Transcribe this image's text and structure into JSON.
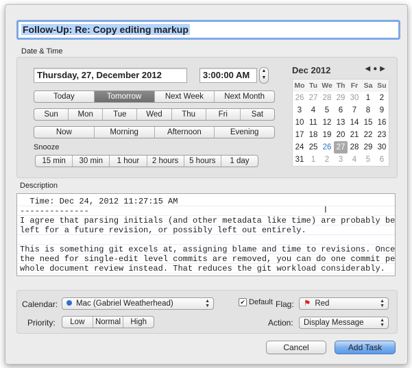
{
  "task_title": "Follow-Up: Re: Copy editing markup",
  "date_time_section": {
    "label": "Date & Time",
    "date_value": "Thursday, 27, December 2012",
    "time_value": "3:00:00 AM",
    "quick_days": [
      "Today",
      "Tomorrow",
      "Next Week",
      "Next Month"
    ],
    "quick_days_active": "Tomorrow",
    "weekdays": [
      "Sun",
      "Mon",
      "Tue",
      "Wed",
      "Thu",
      "Fri",
      "Sat"
    ],
    "times_of_day": [
      "Now",
      "Morning",
      "Afternoon",
      "Evening"
    ],
    "snooze_label": "Snooze",
    "snooze_options": [
      "15 min",
      "30 min",
      "1 hour",
      "2 hours",
      "5 hours",
      "1 day"
    ]
  },
  "calendar": {
    "month_label": "Dec 2012",
    "nav": {
      "prev": "◀",
      "today": "●",
      "next": "▶"
    },
    "dow": [
      "Mo",
      "Tu",
      "We",
      "Th",
      "Fr",
      "Sa",
      "Su"
    ],
    "weeks": [
      [
        "26",
        "27",
        "28",
        "29",
        "30",
        "1",
        "2"
      ],
      [
        "3",
        "4",
        "5",
        "6",
        "7",
        "8",
        "9"
      ],
      [
        "10",
        "11",
        "12",
        "13",
        "14",
        "15",
        "16"
      ],
      [
        "17",
        "18",
        "19",
        "20",
        "21",
        "22",
        "23"
      ],
      [
        "24",
        "25",
        "26",
        "27",
        "28",
        "29",
        "30"
      ],
      [
        "31",
        "1",
        "2",
        "3",
        "4",
        "5",
        "6"
      ]
    ],
    "today": "26",
    "selected": "27"
  },
  "description": {
    "label": "Description",
    "text": "  Time: Dec 24, 2012 11:27:15 AM\n--------------\nI agree that parsing initials (and other metadata like time) are probably best\nleft for a future revision, or possibly left out entirely.\n\nThis is something git excels at, assigning blame and time to revisions. Once\nthe need for single-edit level commits are removed, you can do one commit per\nwhole document review instead. That reduces the git workload considerably."
  },
  "options": {
    "calendar_label": "Calendar:",
    "calendar_value": "Mac (Gabriel Weatherhead)",
    "calendar_color": "#2f6fd1",
    "default_label": "Default",
    "default_checked": true,
    "flag_label": "Flag:",
    "flag_value": "Red",
    "flag_color": "#d9241c",
    "priority_label": "Priority:",
    "priority_options": [
      "Low",
      "Normal",
      "High"
    ],
    "action_label": "Action:",
    "action_value": "Display Message"
  },
  "buttons": {
    "cancel": "Cancel",
    "add_task": "Add Task"
  }
}
